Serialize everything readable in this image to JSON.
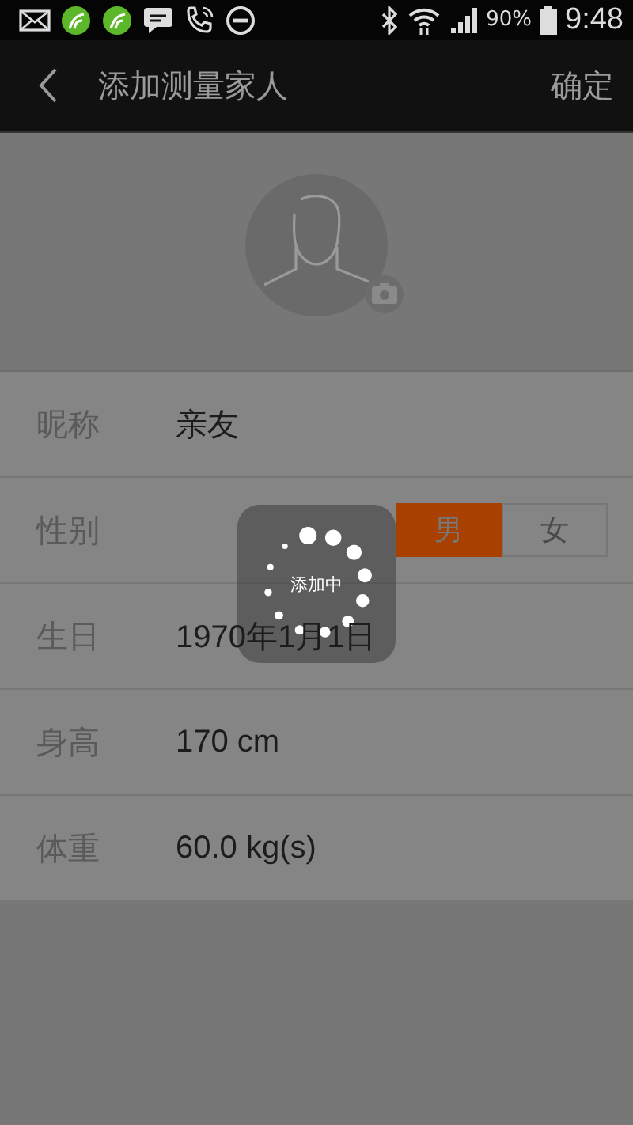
{
  "status_bar": {
    "battery": "90%",
    "time": "9:48"
  },
  "header": {
    "title": "添加测量家人",
    "action": "确定"
  },
  "form": [
    {
      "kind": "text",
      "label": "昵称",
      "value": "亲友"
    },
    {
      "kind": "toggle",
      "label": "性别",
      "options": [
        {
          "label": "男",
          "selected": true
        },
        {
          "label": "女",
          "selected": false
        }
      ]
    },
    {
      "kind": "text",
      "label": "生日",
      "value": "1970年1月1日"
    },
    {
      "kind": "text",
      "label": "身高",
      "value": "170 cm"
    },
    {
      "kind": "text",
      "label": "体重",
      "value": "60.0 kg(s)"
    }
  ],
  "loading": {
    "label": "添加中"
  }
}
